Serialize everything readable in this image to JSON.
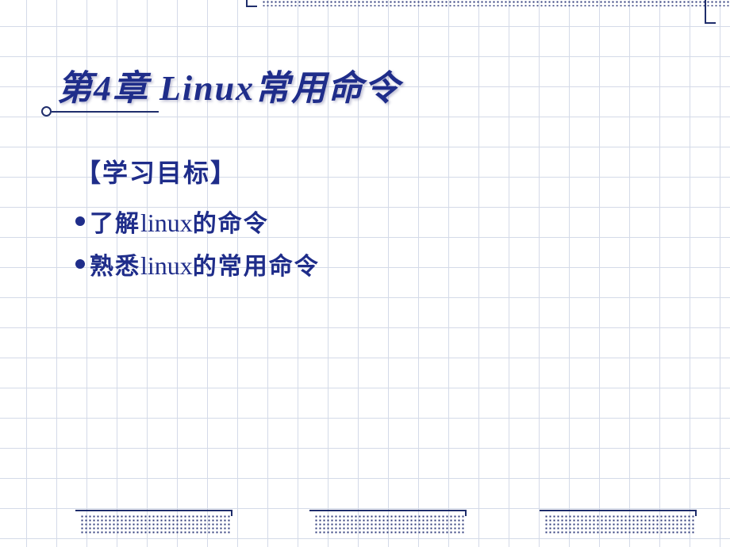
{
  "title": "第4章 Linux常用命令",
  "section_heading": "【学习目标】",
  "bullets": [
    {
      "prefix": "了解",
      "latin": "linux",
      "suffix": "的命令"
    },
    {
      "prefix": "熟悉",
      "latin": "linux",
      "suffix": "的常用命令"
    }
  ]
}
